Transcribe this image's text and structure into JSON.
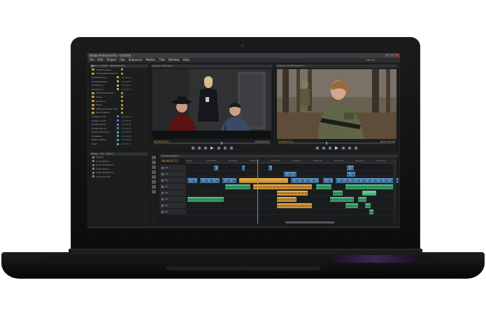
{
  "app": {
    "title": "Adobe Premiere Pro - Untitled",
    "workspace": "Editing",
    "menu": [
      "File",
      "Edit",
      "Project",
      "Clip",
      "Sequence",
      "Marker",
      "Title",
      "Window",
      "Help"
    ]
  },
  "project_panel": {
    "tab": "Project: Untitled · Media Browser",
    "items": [
      {
        "label": "Untitled.prproj",
        "kind": "bin",
        "duration": "",
        "swatch": "#c29b3a"
      },
      {
        "label": "Interrogation Sequence",
        "kind": "bin",
        "duration": "",
        "swatch": "#c29b3a"
      },
      {
        "label": "Rooftop Ext 01",
        "kind": "clip",
        "duration": "00:00:05",
        "swatch": "#d9c04a"
      },
      {
        "label": "Rooftop Ext 02",
        "kind": "clip",
        "duration": "00:00:07",
        "swatch": "#d9c04a"
      },
      {
        "label": "Int Room A",
        "kind": "clip",
        "duration": "00:00:12",
        "swatch": "#d9c04a"
      },
      {
        "label": "Int Room B",
        "kind": "clip",
        "duration": "00:00:09",
        "swatch": "#d9c04a"
      },
      {
        "label": "Forest Sequence",
        "kind": "bin",
        "duration": "",
        "swatch": "#c29b3a"
      },
      {
        "label": "Audio",
        "kind": "bin",
        "duration": "",
        "swatch": "#c29b3a"
      },
      {
        "label": "Graphics",
        "kind": "bin",
        "duration": "",
        "swatch": "#c29b3a"
      },
      {
        "label": "Music",
        "kind": "bin",
        "duration": "",
        "swatch": "#c29b3a"
      },
      {
        "label": "Titles and Lower Thirds",
        "kind": "bin",
        "duration": "",
        "swatch": "#c29b3a"
      },
      {
        "label": "Final Outputs",
        "kind": "bin",
        "duration": "",
        "swatch": "#c29b3a"
      },
      {
        "label": "Soldier CU 01",
        "kind": "clip",
        "duration": "00:00:04",
        "swatch": "#4f8fd6"
      },
      {
        "label": "Soldier CU 02",
        "kind": "clip",
        "duration": "00:00:06",
        "swatch": "#4f8fd6"
      },
      {
        "label": "Soldier WS 01",
        "kind": "clip",
        "duration": "00:00:08",
        "swatch": "#4f8fd6"
      },
      {
        "label": "Soldier WS 02",
        "kind": "clip",
        "duration": "00:00:03",
        "swatch": "#4f8fd6"
      },
      {
        "label": "Forest Ambience",
        "kind": "clip",
        "duration": "00:00:15",
        "swatch": "#4fc28a"
      },
      {
        "label": "Footsteps",
        "kind": "clip",
        "duration": "00:00:02",
        "swatch": "#4fc28a"
      },
      {
        "label": "Radio Chatter",
        "kind": "clip",
        "duration": "00:00:05",
        "swatch": "#4fc28a"
      },
      {
        "label": "Wind",
        "kind": "clip",
        "duration": "00:00:11",
        "swatch": "#4fc28a"
      }
    ]
  },
  "source_monitor": {
    "tab": "Source: Int Room A",
    "timecode_in": "00;00;14;20",
    "timecode_out": "00;00;24;11",
    "playhead_fraction": 0.58
  },
  "program_monitor": {
    "tab": "Program: Forest Sequence",
    "timecode_in": "00;00;07;11",
    "timecode_out": "00;01;29;20",
    "playhead_fraction": 0.41
  },
  "effects_panel": {
    "tab": "Effects · Info · History",
    "items": [
      "Presets",
      "Audio Effects",
      "Audio Transitions",
      "Video Effects",
      "Video Transitions",
      "Lumetri Looks"
    ]
  },
  "timeline": {
    "tab": "Forest Sequence",
    "timecode": "00;00;07;11",
    "ruler": [
      "00;00",
      "00;00;08",
      "00;00;16",
      "00;00;24",
      "00;00;32",
      "00;00;40",
      "00;00;48",
      "00;00;56",
      "00;01;04",
      "00;01;12"
    ],
    "tracks": [
      "V3",
      "V2",
      "V1",
      "A1",
      "A2",
      "A3",
      "A4",
      "A5"
    ]
  },
  "colors": {
    "video_clip": "#4f8fd6",
    "audio_clip": "#4fc28a",
    "selected_clip": "#f0b24e",
    "timecode": "#e6b12e",
    "playhead": "#4a9fff"
  }
}
